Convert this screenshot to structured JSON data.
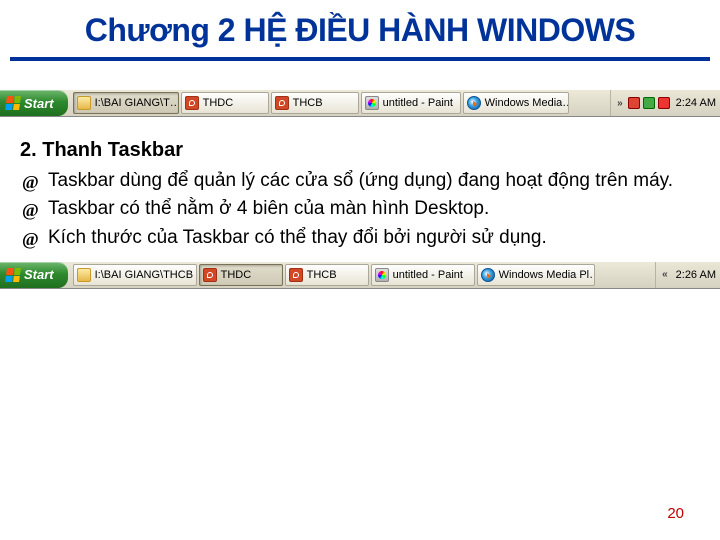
{
  "title": "Chương 2 HỆ ĐIỀU HÀNH WINDOWS",
  "section_heading": "2. Thanh Taskbar",
  "bullets": [
    "Taskbar dùng để quản lý các cửa sổ (ứng dụng) đang hoạt động trên máy.",
    "Taskbar có thể nằm ở 4 biên của màn hình Desktop.",
    "Kích thước của Taskbar có thể thay đổi bởi người sử dụng."
  ],
  "taskbar1": {
    "start": "Start",
    "items": [
      {
        "label": "I:\\BAI GIANG\\T…",
        "icon": "folder",
        "active": true
      },
      {
        "label": "THDC",
        "icon": "ppt",
        "active": false
      },
      {
        "label": "THCB",
        "icon": "ppt",
        "active": false
      },
      {
        "label": "untitled - Paint",
        "icon": "paint",
        "active": false
      },
      {
        "label": "Windows Media…",
        "icon": "wmp",
        "active": false
      }
    ],
    "clock": "2:24 AM"
  },
  "taskbar2": {
    "start": "Start",
    "items": [
      {
        "label": "I:\\BAI GIANG\\THCB",
        "icon": "folder",
        "active": false
      },
      {
        "label": "THDC",
        "icon": "ppt",
        "active": true
      },
      {
        "label": "THCB",
        "icon": "ppt",
        "active": false
      },
      {
        "label": "untitled - Paint",
        "icon": "paint",
        "active": false
      },
      {
        "label": "Windows Media Pl…",
        "icon": "wmp",
        "active": false
      }
    ],
    "clock": "2:26 AM"
  },
  "page_number": "20"
}
